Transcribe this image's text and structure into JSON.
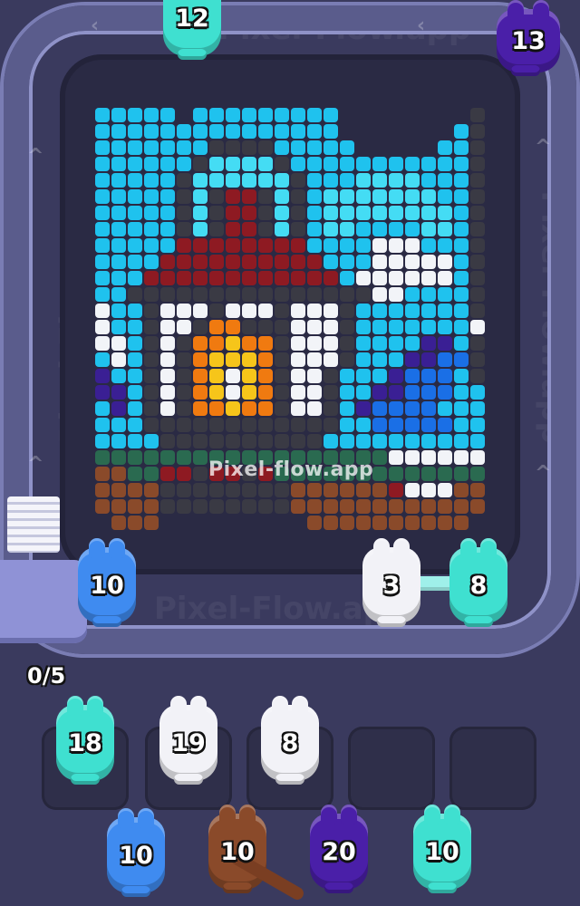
{
  "watermark": {
    "board_text": "Pixel-flow.app",
    "background_text": "Pixel-Flow.app"
  },
  "progress_counter": "0/5",
  "belt_critters": [
    {
      "count": "12",
      "color": "#3fe0d0"
    },
    {
      "count": "13",
      "color": "#4a1fa8"
    },
    {
      "count": "10",
      "color": "#3f8bf0"
    },
    {
      "count": "3",
      "color": "#f2f2f7"
    },
    {
      "count": "8",
      "color": "#3fe0d0"
    }
  ],
  "tray_critters": [
    {
      "count": "18",
      "color": "#3fe0d0"
    },
    {
      "count": "19",
      "color": "#f2f2f7"
    },
    {
      "count": "8",
      "color": "#f2f2f7"
    }
  ],
  "empty_slots": 2,
  "queue_critters": [
    {
      "count": "10",
      "color": "#3f8bf0"
    },
    {
      "count": "10",
      "color": "#8a4a2a"
    },
    {
      "count": "20",
      "color": "#4a1fa8"
    },
    {
      "count": "10",
      "color": "#3fe0d0"
    }
  ],
  "palette": {
    "S": "#1fc2ee",
    "L": "#44dcf4",
    "B": "#1a6fe6",
    "W": "#f2f4f8",
    "K": "#3a3a44",
    "R": "#8e1a22",
    "O": "#f07a10",
    "Y": "#f6c51a",
    "P": "#3a1f94",
    "G": "#2a6a50",
    "N": "#8a4a2a",
    ".": "#2a2a44"
  },
  "pixel_art": [
    "........................",
    "SSSSS.SSSSSSSSS........K",
    "SSSSSSSSSSSSSSS.......SK",
    "SSSSSSSKKKKSSSSS.....SSK",
    "SSSSSSKLLLLKSSSSSSSSSSSK",
    "SSSSSKLLLLLLKSSSLLLLSSSK",
    "SSSSSKLKRRKLKSLLLLLLLSSK",
    "SSSSSKLKRRKLKSLLLLLLLLSK",
    "SSSSSKLKRRKLKSLLSSSSLLSK",
    "SSSSSRRRRRRRRSSSSWWWSSSK",
    "SSSSRRRRRRRRRRSSSWWWWWSK",
    "SSSRRRRRRRRRRRRSWWWWWWSK",
    "SSKKKKKKKKKKKKKKKWWSSSSK",
    "WSSKWWWKWWWKWWWKSSSSSSSK",
    "WSSKWWKOOKKKWWWKSSSSSSSW",
    "WWSKWKOOYOOKWWWKSSSSPPSK",
    "SWSKWKOYYYOKWWWKSSSPPBBK",
    "PSSKWKOYWYOKWWKSSSPBBBSK",
    "PPSKWKOYWYOKWWKSSPPBBBSS",
    "SPSKWKOOYOOKWWKSPBBBBSSS",
    "SSSKKKKKKKKKKKKSSBBBBBSS",
    "SSSSKKKKKKKKKKSSSSSSSSSS",
    "GGGGGGGGGGGGGGGGGGWWWWWW",
    "NNGGRRKRRKRGGGGGGGGGGGGG",
    "NNNNKKKKKKKKNNNNNNRWWWNN",
    "NNNNKKKKKKKKNNNNNNNNNNNN",
    ".NNN.........NNNNNNNNNN."
  ]
}
